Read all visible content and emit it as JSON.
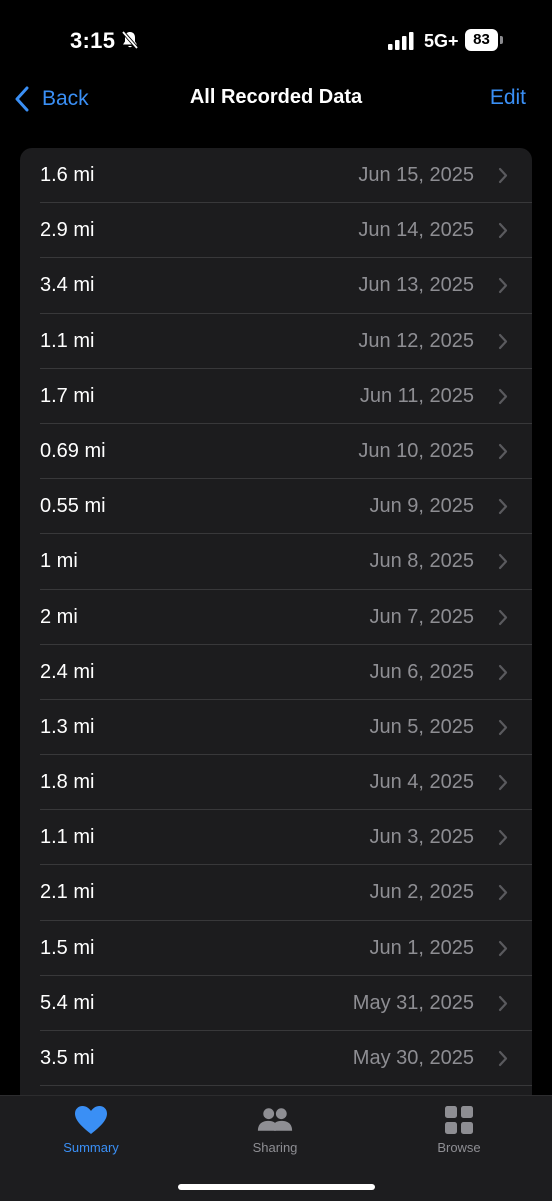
{
  "status_bar": {
    "time": "3:15",
    "network": "5G+",
    "battery": "83"
  },
  "nav": {
    "back_label": "Back",
    "title": "All Recorded Data",
    "edit_label": "Edit"
  },
  "records": [
    {
      "value": "1.6 mi",
      "date": "Jun 15, 2025"
    },
    {
      "value": "2.9 mi",
      "date": "Jun 14, 2025"
    },
    {
      "value": "3.4 mi",
      "date": "Jun 13, 2025"
    },
    {
      "value": "1.1 mi",
      "date": "Jun 12, 2025"
    },
    {
      "value": "1.7 mi",
      "date": "Jun 11, 2025"
    },
    {
      "value": "0.69 mi",
      "date": "Jun 10, 2025"
    },
    {
      "value": "0.55 mi",
      "date": "Jun 9, 2025"
    },
    {
      "value": "1 mi",
      "date": "Jun 8, 2025"
    },
    {
      "value": "2 mi",
      "date": "Jun 7, 2025"
    },
    {
      "value": "2.4 mi",
      "date": "Jun 6, 2025"
    },
    {
      "value": "1.3 mi",
      "date": "Jun 5, 2025"
    },
    {
      "value": "1.8 mi",
      "date": "Jun 4, 2025"
    },
    {
      "value": "1.1 mi",
      "date": "Jun 3, 2025"
    },
    {
      "value": "2.1 mi",
      "date": "Jun 2, 2025"
    },
    {
      "value": "1.5 mi",
      "date": "Jun 1, 2025"
    },
    {
      "value": "5.4 mi",
      "date": "May 31, 2025"
    },
    {
      "value": "3.5 mi",
      "date": "May 30, 2025"
    }
  ],
  "tabs": [
    {
      "label": "Summary",
      "icon": "heart-icon",
      "active": true
    },
    {
      "label": "Sharing",
      "icon": "people-icon",
      "active": false
    },
    {
      "label": "Browse",
      "icon": "grid-icon",
      "active": false
    }
  ],
  "colors": {
    "accent": "#3a8ff5",
    "background": "#000000",
    "list_background": "#1c1c1e",
    "secondary_text": "#8e8e93"
  }
}
